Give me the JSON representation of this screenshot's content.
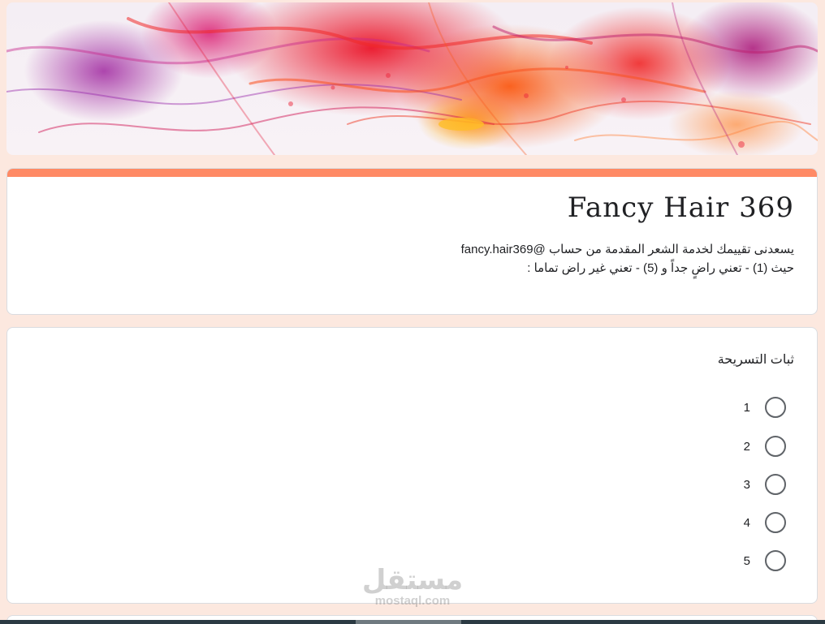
{
  "form": {
    "title": "Fancy Hair 369",
    "description_line1": "يسعدنى تقييمك لخدمة الشعر المقدمة من حساب @fancy.hair369",
    "description_line2": "حيث (1) - تعني راضٍ جداً و (5) - تعني غير راض تماما :"
  },
  "question": {
    "title": "ثبات التسريحة",
    "options": [
      "1",
      "2",
      "3",
      "4",
      "5"
    ]
  },
  "watermark": {
    "arabic": "مستقل",
    "latin": "mostaql.com"
  },
  "colors": {
    "accent": "#ff8a65",
    "background": "#fce8df",
    "radio_border": "#5f6368"
  }
}
